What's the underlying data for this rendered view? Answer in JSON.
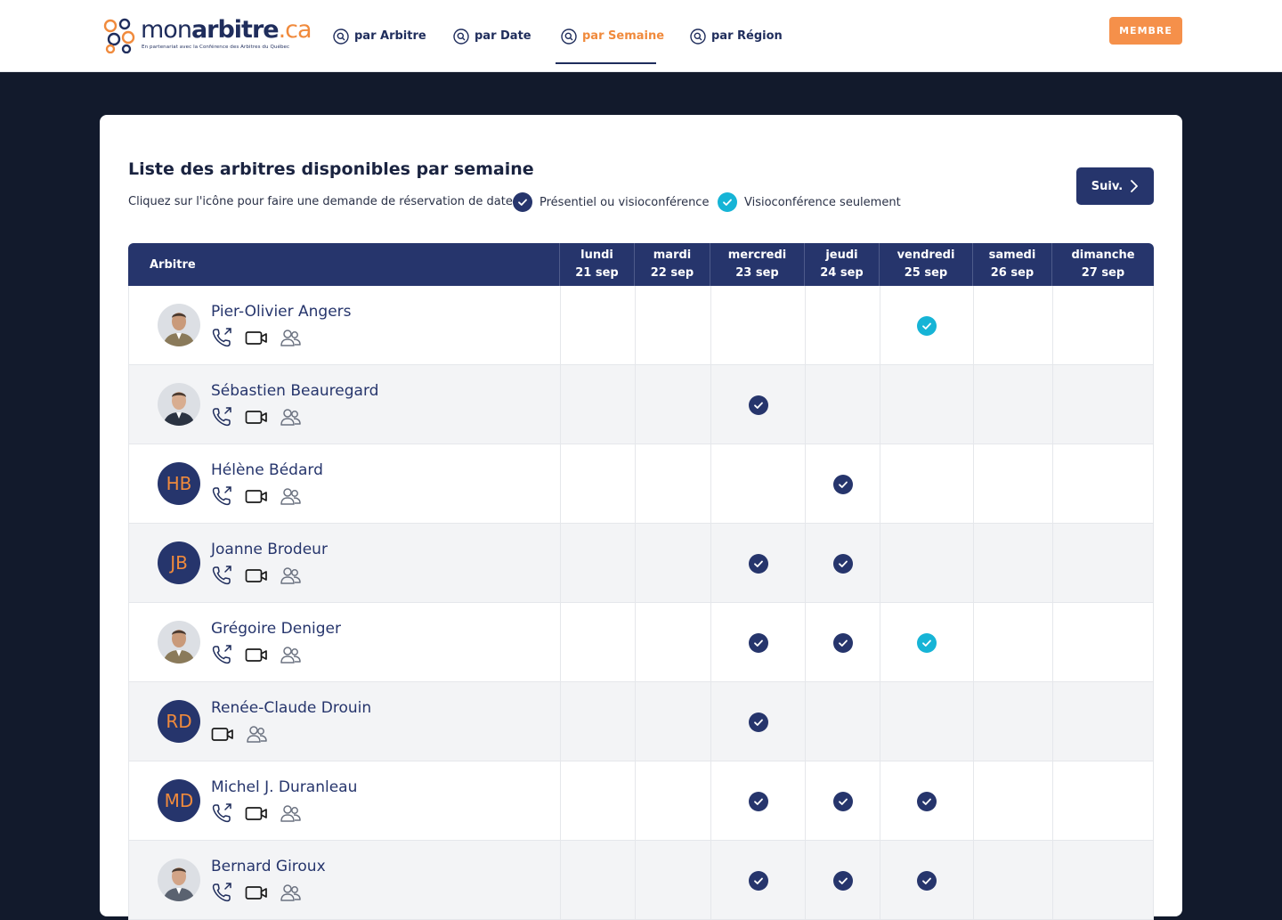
{
  "brand": {
    "name_part1": "mon",
    "name_part2": "arbitre",
    "name_part3": ".ca",
    "tagline": "En partenariat avec la Conférence des Arbitres du Québec",
    "accent_color": "#f08a3c",
    "navy_color": "#26356c"
  },
  "nav": {
    "items": [
      {
        "label": "par Arbitre",
        "icon": "search-icon",
        "active": false
      },
      {
        "label": "par Date",
        "icon": "search-icon",
        "active": false
      },
      {
        "label": "par Semaine",
        "icon": "search-icon",
        "active": true
      },
      {
        "label": "par Région",
        "icon": "search-icon",
        "active": false
      }
    ],
    "member_label": "MEMBRE"
  },
  "page": {
    "title": "Liste des arbitres disponibles par semaine",
    "instructions": "Cliquez sur l'icône pour faire une demande de réservation de date.",
    "legend_inperson": "Présentiel ou visioconférence",
    "legend_video": "Visioconférence seulement",
    "legend_inperson_color": "#26356c",
    "legend_video_color": "#16b4d6",
    "next_label": "Suiv."
  },
  "table": {
    "arbitre_header": "Arbitre",
    "days": [
      {
        "day": "lundi",
        "date": "21 sep"
      },
      {
        "day": "mardi",
        "date": "22 sep"
      },
      {
        "day": "mercredi",
        "date": "23 sep"
      },
      {
        "day": "jeudi",
        "date": "24 sep"
      },
      {
        "day": "vendredi",
        "date": "25 sep"
      },
      {
        "day": "samedi",
        "date": "26 sep"
      },
      {
        "day": "dimanche",
        "date": "27 sep"
      }
    ],
    "rows": [
      {
        "name": "Pier-Olivier Angers",
        "avatar": "photo",
        "initials": "",
        "modes": [
          "phone-icon",
          "video-icon",
          "people-icon"
        ],
        "availability": [
          "",
          "",
          "",
          "",
          "video",
          "",
          ""
        ]
      },
      {
        "name": "Sébastien Beauregard",
        "avatar": "photo",
        "initials": "",
        "modes": [
          "phone-icon",
          "video-icon",
          "people-icon"
        ],
        "availability": [
          "",
          "",
          "both",
          "",
          "",
          "",
          ""
        ]
      },
      {
        "name": "Hélène Bédard",
        "avatar": "initials",
        "initials": "HB",
        "modes": [
          "phone-icon",
          "video-icon",
          "people-icon"
        ],
        "availability": [
          "",
          "",
          "",
          "both",
          "",
          "",
          ""
        ]
      },
      {
        "name": "Joanne Brodeur",
        "avatar": "initials",
        "initials": "JB",
        "modes": [
          "phone-icon",
          "video-icon",
          "people-icon"
        ],
        "availability": [
          "",
          "",
          "both",
          "both",
          "",
          "",
          ""
        ]
      },
      {
        "name": "Grégoire Deniger",
        "avatar": "photo",
        "initials": "",
        "modes": [
          "phone-icon",
          "video-icon",
          "people-icon"
        ],
        "availability": [
          "",
          "",
          "both",
          "both",
          "video",
          "",
          ""
        ]
      },
      {
        "name": "Renée-Claude Drouin",
        "avatar": "initials",
        "initials": "RD",
        "modes": [
          "video-icon",
          "people-icon"
        ],
        "availability": [
          "",
          "",
          "both",
          "",
          "",
          "",
          ""
        ]
      },
      {
        "name": "Michel J. Duranleau",
        "avatar": "initials",
        "initials": "MD",
        "modes": [
          "phone-icon",
          "video-icon",
          "people-icon"
        ],
        "availability": [
          "",
          "",
          "both",
          "both",
          "both",
          "",
          ""
        ]
      },
      {
        "name": "Bernard Giroux",
        "avatar": "photo",
        "initials": "",
        "modes": [
          "phone-icon",
          "video-icon",
          "people-icon"
        ],
        "availability": [
          "",
          "",
          "both",
          "both",
          "both",
          "",
          ""
        ]
      }
    ]
  }
}
